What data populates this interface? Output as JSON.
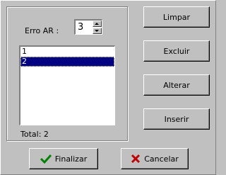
{
  "form": {
    "erro_label": "Erro  AR :",
    "spin_value": "3",
    "list_items": [
      "1",
      "2"
    ],
    "selected_index": 1,
    "total_label": "Total: 2"
  },
  "buttons": {
    "limpar": "Limpar",
    "excluir": "Excluir",
    "alterar": "Alterar",
    "inserir": "Inserir",
    "finalizar": "Finalizar",
    "cancelar": "Cancelar"
  },
  "icons": {
    "finalizar": "check-icon",
    "cancelar": "x-icon"
  },
  "colors": {
    "selection": "#000080",
    "check": "#008000",
    "cancel": "#c00000"
  }
}
